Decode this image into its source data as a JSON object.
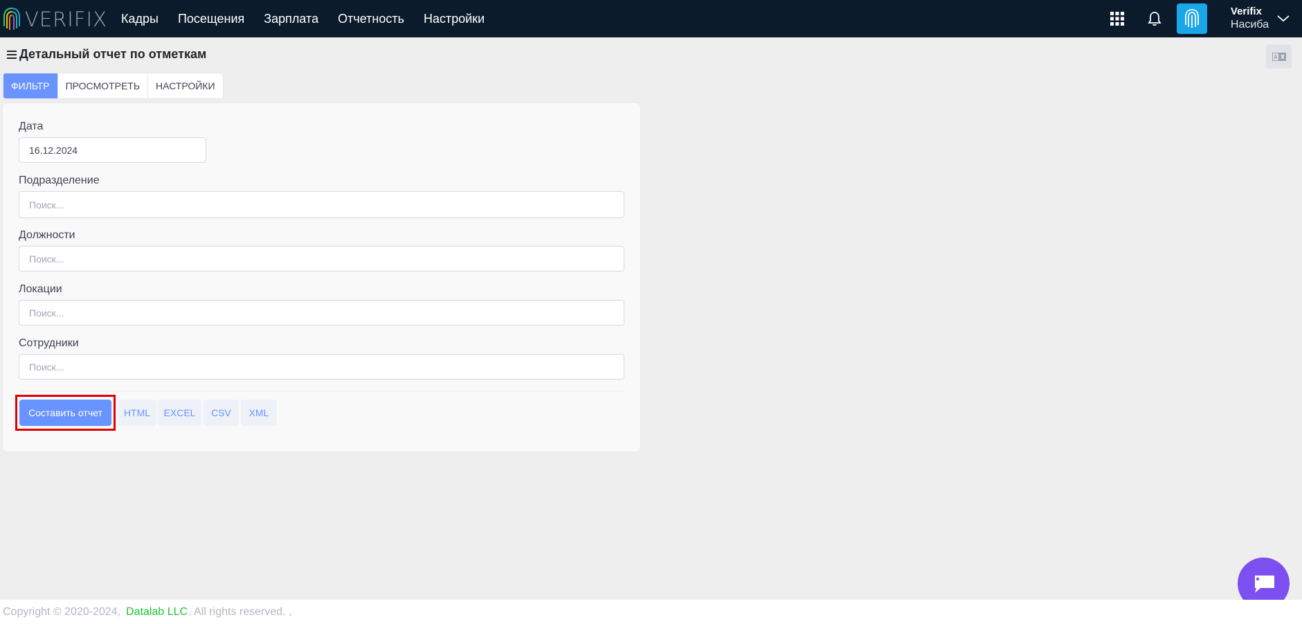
{
  "brand": {
    "name": "VERIFIX"
  },
  "nav": {
    "items": [
      {
        "label": "Кадры"
      },
      {
        "label": "Посещения"
      },
      {
        "label": "Зарплата"
      },
      {
        "label": "Отчетность"
      },
      {
        "label": "Настройки"
      }
    ]
  },
  "user": {
    "company": "Verifix",
    "name": "Насиба"
  },
  "icons": {
    "apps": "grid-apps-icon",
    "notifications": "bell-icon",
    "avatar": "fingerprint-icon",
    "menu": "hamburger-icon",
    "lang": "translate-icon",
    "chat": "chat-bubble-icon",
    "user_menu": "chevron-down-icon"
  },
  "colors": {
    "navbar": "#0b1b2b",
    "primary": "#6993ff",
    "avatar_bg": "#1aa6e8",
    "chat_bg": "#7b4ff0",
    "highlight": "#e00000",
    "footer_link": "#1bc531"
  },
  "page": {
    "title": "Детальный отчет по отметкам"
  },
  "tabs": [
    {
      "label": "ФИЛЬТР",
      "active": true
    },
    {
      "label": "ПРОСМОТРЕТЬ",
      "active": false
    },
    {
      "label": "НАСТРОЙКИ",
      "active": false
    }
  ],
  "form": {
    "date": {
      "label": "Дата",
      "value": "16.12.2024"
    },
    "division": {
      "label": "Подразделение",
      "placeholder": "Поиск..."
    },
    "positions": {
      "label": "Должности",
      "placeholder": "Поиск..."
    },
    "locations": {
      "label": "Локации",
      "placeholder": "Поиск..."
    },
    "employees": {
      "label": "Сотрудники",
      "placeholder": "Поиск..."
    }
  },
  "actions": {
    "generate": "Составить отчет",
    "html": "HTML",
    "excel": "EXCEL",
    "csv": "CSV",
    "xml": "XML"
  },
  "footer": {
    "copyright": "Copyright © 2020-2024,",
    "company_link": "Datalab LLC",
    "rights": ". All rights reserved. ,"
  }
}
